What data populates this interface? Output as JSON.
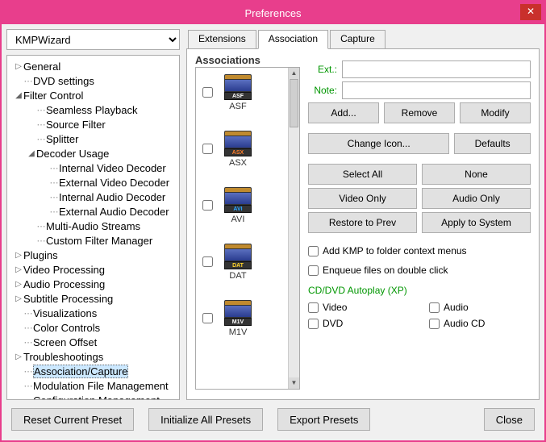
{
  "window": {
    "title": "Preferences",
    "close": "✕"
  },
  "preset": {
    "selected": "KMPWizard"
  },
  "tree": [
    {
      "label": "General",
      "depth": 1,
      "exp": "▷"
    },
    {
      "label": "DVD settings",
      "depth": 1,
      "exp": ""
    },
    {
      "label": "Filter Control",
      "depth": 1,
      "exp": "◢"
    },
    {
      "label": "Seamless Playback",
      "depth": 2,
      "exp": ""
    },
    {
      "label": "Source Filter",
      "depth": 2,
      "exp": ""
    },
    {
      "label": "Splitter",
      "depth": 2,
      "exp": ""
    },
    {
      "label": "Decoder Usage",
      "depth": 2,
      "exp": "◢"
    },
    {
      "label": "Internal Video Decoder",
      "depth": 3,
      "exp": ""
    },
    {
      "label": "External Video Decoder",
      "depth": 3,
      "exp": ""
    },
    {
      "label": "Internal Audio Decoder",
      "depth": 3,
      "exp": ""
    },
    {
      "label": "External Audio Decoder",
      "depth": 3,
      "exp": ""
    },
    {
      "label": "Multi-Audio Streams",
      "depth": 2,
      "exp": ""
    },
    {
      "label": "Custom Filter Manager",
      "depth": 2,
      "exp": ""
    },
    {
      "label": "Plugins",
      "depth": 1,
      "exp": "▷"
    },
    {
      "label": "Video Processing",
      "depth": 1,
      "exp": "▷"
    },
    {
      "label": "Audio Processing",
      "depth": 1,
      "exp": "▷"
    },
    {
      "label": "Subtitle Processing",
      "depth": 1,
      "exp": "▷"
    },
    {
      "label": "Visualizations",
      "depth": 1,
      "exp": ""
    },
    {
      "label": "Color Controls",
      "depth": 1,
      "exp": ""
    },
    {
      "label": "Screen Offset",
      "depth": 1,
      "exp": ""
    },
    {
      "label": "Troubleshootings",
      "depth": 1,
      "exp": "▷"
    },
    {
      "label": "Association/Capture",
      "depth": 1,
      "exp": "",
      "selected": true
    },
    {
      "label": "Modulation File Management",
      "depth": 1,
      "exp": ""
    },
    {
      "label": "Configuration Management",
      "depth": 1,
      "exp": ""
    }
  ],
  "tabs": [
    {
      "label": "Extensions",
      "active": false
    },
    {
      "label": "Association",
      "active": true
    },
    {
      "label": "Capture",
      "active": false
    }
  ],
  "group": "Associations",
  "assoc": [
    "ASF",
    "ASX",
    "AVI",
    "DAT",
    "M1V"
  ],
  "fields": {
    "ext": "Ext.:",
    "note": "Note:"
  },
  "buttons": {
    "add": "Add...",
    "remove": "Remove",
    "modify": "Modify",
    "changeIcon": "Change Icon...",
    "defaults": "Defaults",
    "selectAll": "Select All",
    "none": "None",
    "videoOnly": "Video Only",
    "audioOnly": "Audio Only",
    "restore": "Restore to Prev",
    "apply": "Apply to System"
  },
  "checks": {
    "ctx": "Add KMP to folder context menus",
    "enq": "Enqueue files on double click"
  },
  "autoplay": {
    "title": "CD/DVD Autoplay (XP)",
    "video": "Video",
    "audio": "Audio",
    "dvd": "DVD",
    "audiocd": "Audio CD"
  },
  "bottom": {
    "reset": "Reset Current Preset",
    "init": "Initialize All Presets",
    "export": "Export Presets",
    "close": "Close"
  },
  "iconColors": {
    "ASF": "#fff",
    "ASX": "#ff7f2a",
    "AVI": "#2aa6ff",
    "DAT": "#ffd42a",
    "M1V": "#fff"
  }
}
